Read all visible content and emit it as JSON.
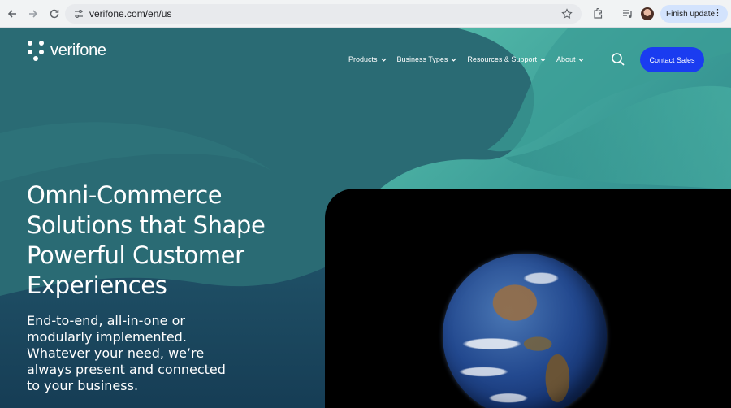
{
  "browser": {
    "url": "verifone.com/en/us",
    "finish_update_label": "Finish update",
    "icons": [
      "back-icon",
      "forward-icon",
      "reload-icon",
      "site-settings-icon",
      "bookmark-star-icon",
      "extensions-icon",
      "media-controls-icon",
      "profile-avatar",
      "more-menu-icon"
    ]
  },
  "site": {
    "logo_text": "verifone",
    "nav": [
      {
        "label": "Products"
      },
      {
        "label": "Business Types"
      },
      {
        "label": "Resources & Support"
      },
      {
        "label": "About"
      }
    ],
    "contact_label": "Contact Sales",
    "hero": {
      "title": "Omni-Commerce Solutions that Shape Powerful Customer Experiences",
      "subtitle": "End-to-end, all-in-one or modularly implemented. Whatever your need, we’re always present and connected to your business."
    },
    "colors": {
      "accent": "#1a3cf0",
      "teal_bg": "#2a6c74",
      "light_teal": "#4cb3a4"
    }
  }
}
